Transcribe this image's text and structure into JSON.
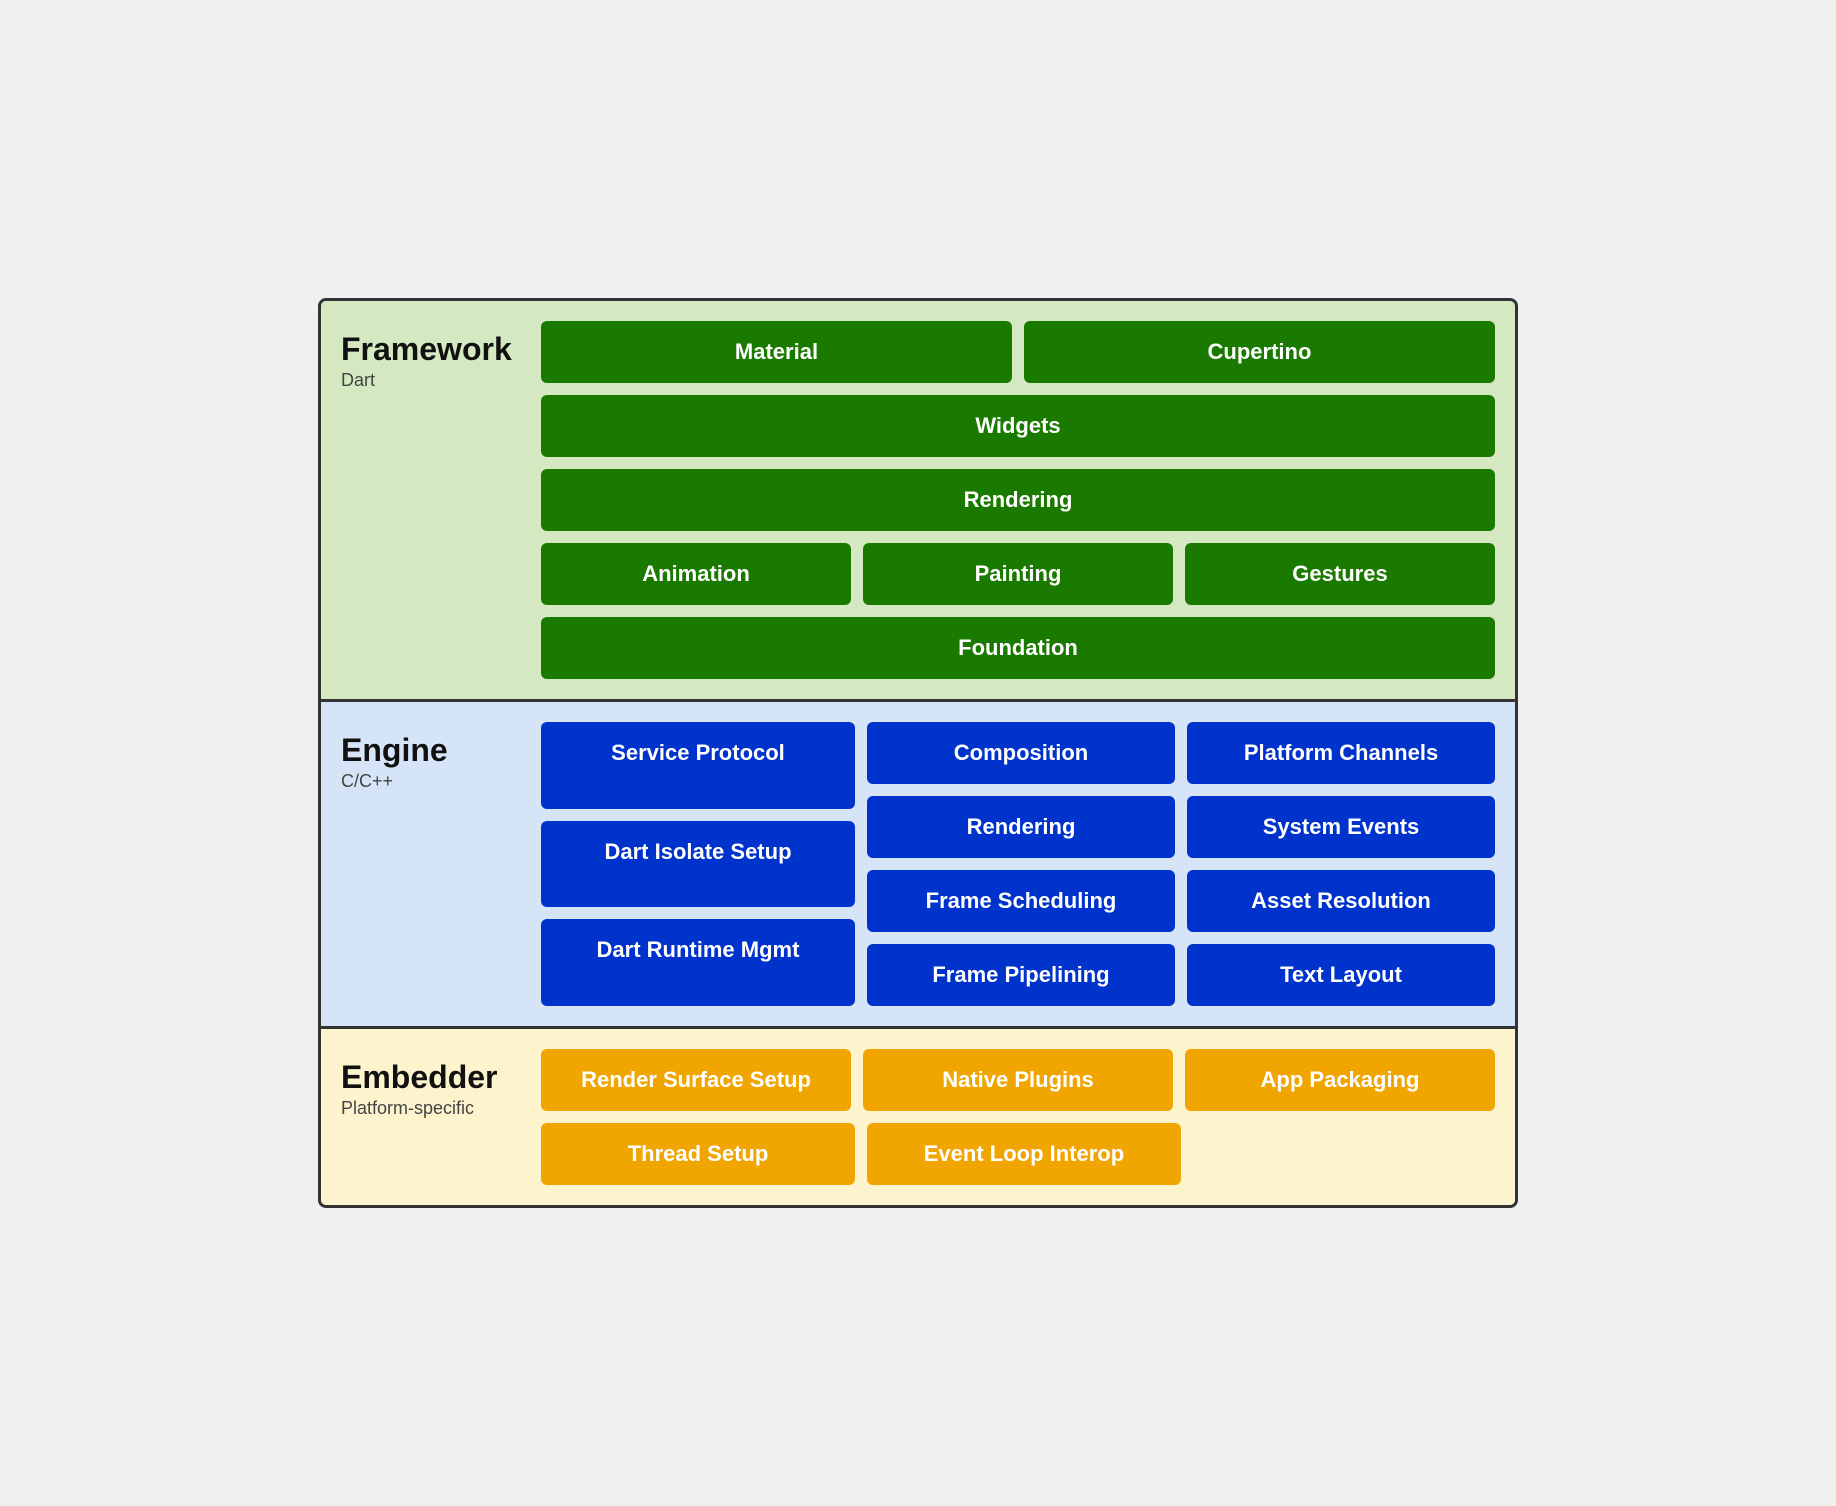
{
  "framework": {
    "title": "Framework",
    "subtitle": "Dart",
    "row1": [
      "Material",
      "Cupertino"
    ],
    "row2": [
      "Widgets"
    ],
    "row3": [
      "Rendering"
    ],
    "row4": [
      "Animation",
      "Painting",
      "Gestures"
    ],
    "row5": [
      "Foundation"
    ]
  },
  "engine": {
    "title": "Engine",
    "subtitle": "C/C++",
    "leftCol": [
      "Service Protocol",
      "Dart Isolate Setup",
      "Dart Runtime Mgmt"
    ],
    "rightRows": [
      [
        "Composition",
        "Platform Channels"
      ],
      [
        "Rendering",
        "System Events"
      ],
      [
        "Frame Scheduling",
        "Asset Resolution"
      ],
      [
        "Frame Pipelining",
        "Text Layout"
      ]
    ]
  },
  "embedder": {
    "title": "Embedder",
    "subtitle": "Platform-specific",
    "row1": [
      "Render Surface Setup",
      "Native Plugins",
      "App Packaging"
    ],
    "row2": [
      "Thread Setup",
      "Event Loop Interop"
    ]
  }
}
